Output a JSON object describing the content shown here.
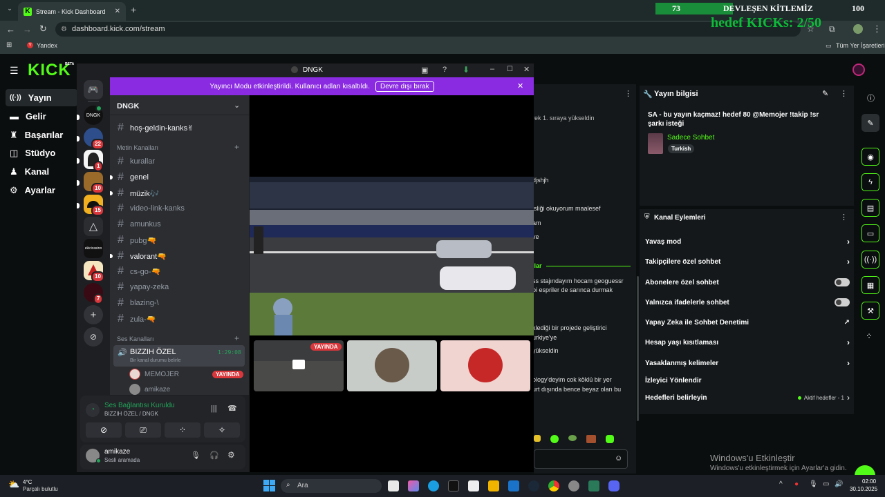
{
  "browser": {
    "tab_title": "Stream - Kick Dashboard",
    "url": "dashboard.kick.com/stream",
    "bookmark_yandex": "Yandex",
    "bookmarks_all": "Tüm Yer İşaretleri"
  },
  "overlay": {
    "goal_left": "73",
    "goal_title": "DEVLEŞEN KİTLEMİZ",
    "goal_right": "100",
    "kicks_goal": "hedef KICKs: 2/50"
  },
  "kick": {
    "logo": "KICK",
    "logo_beta": "BETA",
    "nav": [
      "Yayın",
      "Gelir",
      "Başarılar",
      "Stüdyo",
      "Kanal",
      "Ayarlar"
    ],
    "accent": "#53fc18"
  },
  "discord": {
    "window_title": "DNGK",
    "banner_text": "Yayıncı Modu etkinleştirildi. Kullanıcı adları kısaltıldı.",
    "banner_button": "Devre dışı bırak",
    "server_name": "DNGK",
    "server_badges": [
      "22",
      "1",
      "10",
      "15",
      "10",
      "7"
    ],
    "server_label_dngk": "DNGK",
    "server_label_ekici": "ekicicasino",
    "top_channel": "hoş-geldin-kanks✌",
    "text_category": "Metin Kanalları",
    "text_channels": [
      {
        "name": "kurallar",
        "unread": false
      },
      {
        "name": "genel",
        "unread": true
      },
      {
        "name": "müzik🎶",
        "unread": true
      },
      {
        "name": "video-link-kanks",
        "unread": false
      },
      {
        "name": "amunkus",
        "unread": false
      },
      {
        "name": "pubg🔫",
        "unread": false
      },
      {
        "name": "valorant🔫",
        "unread": true
      },
      {
        "name": "cs-go-🔫",
        "unread": false
      },
      {
        "name": "yapay-zeka",
        "unread": false
      },
      {
        "name": "blazing-\\",
        "unread": false
      },
      {
        "name": "zula-🔫",
        "unread": false
      }
    ],
    "voice_category": "Ses Kanalları",
    "voice_channel": {
      "name": "BIZZIH ÖZEL",
      "time": "1:29:08",
      "status": "Bir kanal durumu belirle"
    },
    "voice_members": [
      {
        "name": "MEMOJER",
        "live": "YAYINDA"
      },
      {
        "name": "amikaze"
      }
    ],
    "vc_status": "Ses Bağlantısı Kuruldu",
    "vc_sub": "BIZZIH ÖZEL / DNGK",
    "user_name": "amikaze",
    "user_status": "Sesli aramada",
    "thumb_live": "YAYINDA"
  },
  "chat": {
    "head": "rek 1. sıraya yükseldin",
    "messages": [
      {
        "text": "djshjh"
      },
      {
        "text": "isliği okuyorum maalesef"
      },
      {
        "text": "am"
      },
      {
        "text": "ve"
      },
      {
        "text": "llar"
      },
      {
        "text": "ss stajındayım hocam geoguessr"
      },
      {
        "text": "bi espriler de sarınca durmak"
      },
      {
        "text": "klediği bir projede geliştirici"
      },
      {
        "text": "urkiye'ye"
      },
      {
        "text": "yükseldin"
      },
      {
        "text": "ology'deyim cok köklü bir yer"
      },
      {
        "text": "urt dışında bence beyaz olan bu"
      }
    ]
  },
  "stream_info": {
    "header": "Yayın bilgisi",
    "title": "SA - bu yayın kaçmaz! hedef 80 @Memojer !takip !sr şarkı isteği",
    "category": "Sadece Sohbet",
    "tag": "Turkish"
  },
  "channel_actions": {
    "header": "Kanal Eylemleri",
    "items": [
      {
        "label": "Yavaş mod",
        "control": "chevron"
      },
      {
        "label": "Takipçilere özel sohbet",
        "control": "chevron"
      },
      {
        "label": "Abonelere özel sohbet",
        "control": "toggle"
      },
      {
        "label": "Yalnızca ifadelerle sohbet",
        "control": "toggle"
      },
      {
        "label": "Yapay Zeka ile Sohbet Denetimi",
        "control": "external"
      },
      {
        "label": "Hesap yaşı kısıtlaması",
        "control": "chevron"
      },
      {
        "label": "Yasaklanmış kelimeler",
        "control": "chevron"
      },
      {
        "label": "İzleyici Yönlendir",
        "control": "none"
      },
      {
        "label": "Hedefleri belirleyin",
        "control": "chevron",
        "extra": "Aktif hedefler - 1"
      }
    ]
  },
  "windows": {
    "activate_title": "Windows'u Etkinleştir",
    "activate_sub": "Windows'u etkinleştirmek için Ayarlar'a gidin.",
    "weather_temp": "4°C",
    "weather_desc": "Parçalı bulutlu",
    "search": "Ara",
    "time": "02:00",
    "date": "30.10.2025"
  }
}
